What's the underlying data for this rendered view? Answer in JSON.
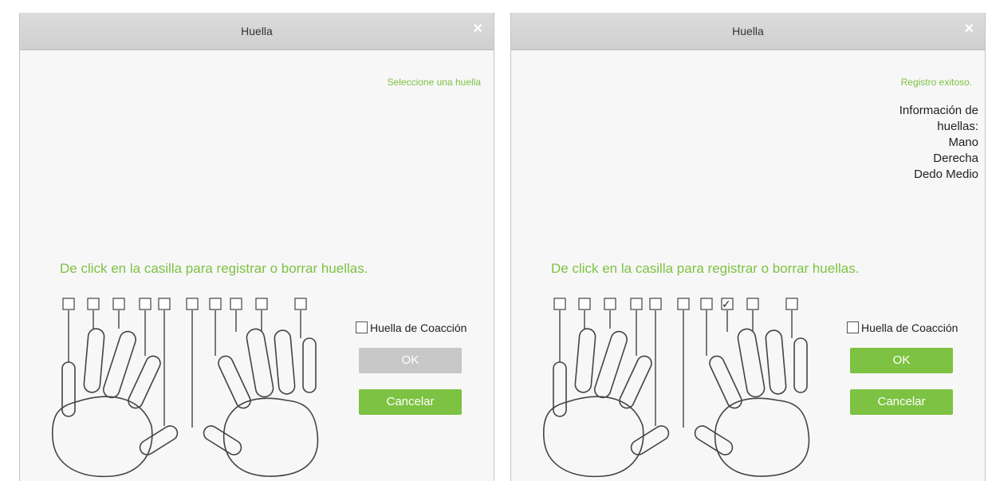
{
  "colors": {
    "accent": "#7dc242",
    "disabled": "#c7c7c7",
    "titlebar": "#d6d6d6"
  },
  "left": {
    "title": "Huella",
    "close_icon": "×",
    "status": "Seleccione una huella",
    "instruction": "De click en la casilla para registrar o borrar huellas.",
    "duress_label": "Huella de Coacción",
    "ok_label": "OK",
    "cancel_label": "Cancelar",
    "checked_finger": null
  },
  "right": {
    "title": "Huella",
    "close_icon": "×",
    "status": "Registro exitoso.",
    "info_lines": [
      "Información de",
      "huellas:",
      "Mano",
      "Derecha",
      "Dedo Medio"
    ],
    "instruction": "De click en la casilla para registrar o borrar huellas.",
    "duress_label": "Huella de Coacción",
    "ok_label": "OK",
    "cancel_label": "Cancelar",
    "checked_finger": "✓"
  }
}
